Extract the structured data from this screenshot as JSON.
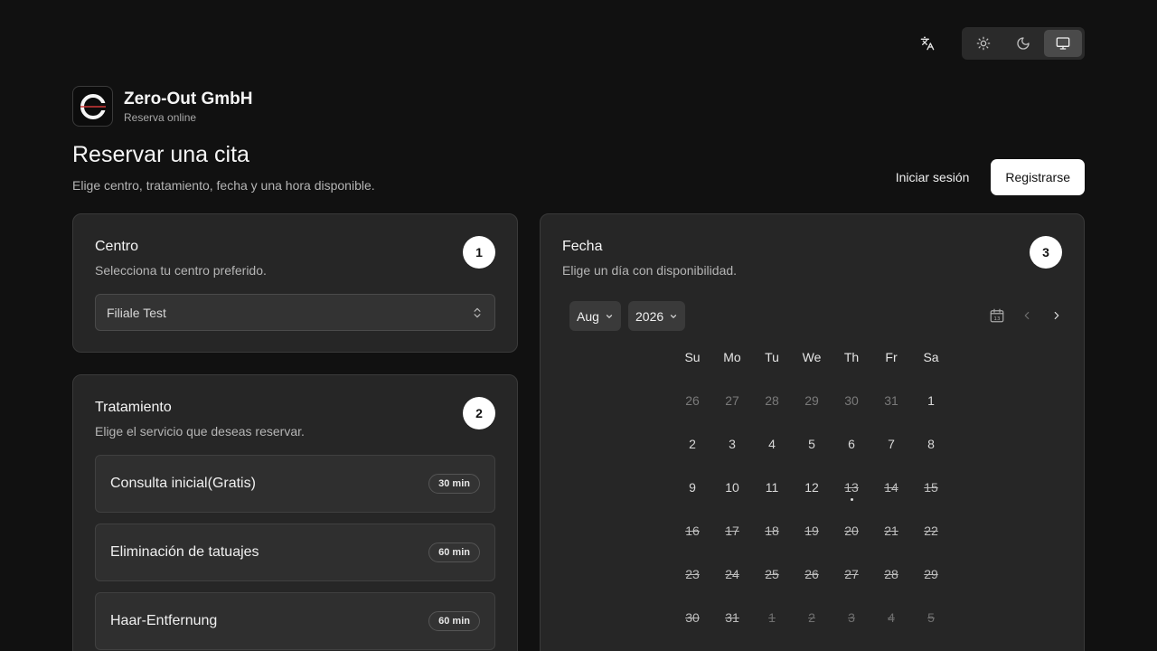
{
  "header": {
    "language_icon": "translate-icon",
    "theme_options": [
      {
        "name": "light",
        "icon": "sun-icon",
        "active": false
      },
      {
        "name": "dark",
        "icon": "moon-icon",
        "active": false
      },
      {
        "name": "system",
        "icon": "monitor-icon",
        "active": true
      }
    ]
  },
  "brand": {
    "name": "Zero-Out GmbH",
    "subtitle": "Reserva online"
  },
  "page": {
    "title": "Reservar una cita",
    "subtitle": "Elige centro, tratamiento, fecha y una hora disponible."
  },
  "auth": {
    "login_label": "Iniciar sesión",
    "register_label": "Registrarse"
  },
  "centro": {
    "step": "1",
    "title": "Centro",
    "description": "Selecciona tu centro preferido.",
    "selected": "Filiale Test"
  },
  "tratamiento": {
    "step": "2",
    "title": "Tratamiento",
    "description": "Elige el servicio que deseas reservar.",
    "services": [
      {
        "name": "Consulta inicial(Gratis)",
        "duration": "30 min"
      },
      {
        "name": "Eliminación de tatuajes",
        "duration": "60 min"
      },
      {
        "name": "Haar-Entfernung",
        "duration": "60 min"
      }
    ]
  },
  "fecha": {
    "step": "3",
    "title": "Fecha",
    "description": "Elige un día con disponibilidad.",
    "month": "Aug",
    "year": "2026",
    "weekdays": [
      "Su",
      "Mo",
      "Tu",
      "We",
      "Th",
      "Fr",
      "Sa"
    ],
    "days": [
      {
        "label": "26",
        "state": "outside"
      },
      {
        "label": "27",
        "state": "outside"
      },
      {
        "label": "28",
        "state": "outside"
      },
      {
        "label": "29",
        "state": "outside"
      },
      {
        "label": "30",
        "state": "outside"
      },
      {
        "label": "31",
        "state": "outside"
      },
      {
        "label": "1",
        "state": "avail"
      },
      {
        "label": "2",
        "state": "avail"
      },
      {
        "label": "3",
        "state": "avail"
      },
      {
        "label": "4",
        "state": "avail"
      },
      {
        "label": "5",
        "state": "avail"
      },
      {
        "label": "6",
        "state": "avail"
      },
      {
        "label": "7",
        "state": "avail"
      },
      {
        "label": "8",
        "state": "avail"
      },
      {
        "label": "9",
        "state": "avail"
      },
      {
        "label": "10",
        "state": "avail"
      },
      {
        "label": "11",
        "state": "avail"
      },
      {
        "label": "12",
        "state": "avail"
      },
      {
        "label": "13",
        "state": "unavail",
        "today": true
      },
      {
        "label": "14",
        "state": "unavail"
      },
      {
        "label": "15",
        "state": "unavail"
      },
      {
        "label": "16",
        "state": "unavail"
      },
      {
        "label": "17",
        "state": "unavail"
      },
      {
        "label": "18",
        "state": "unavail"
      },
      {
        "label": "19",
        "state": "unavail"
      },
      {
        "label": "20",
        "state": "unavail"
      },
      {
        "label": "21",
        "state": "unavail"
      },
      {
        "label": "22",
        "state": "unavail"
      },
      {
        "label": "23",
        "state": "unavail"
      },
      {
        "label": "24",
        "state": "unavail"
      },
      {
        "label": "25",
        "state": "unavail"
      },
      {
        "label": "26",
        "state": "unavail"
      },
      {
        "label": "27",
        "state": "unavail"
      },
      {
        "label": "28",
        "state": "unavail"
      },
      {
        "label": "29",
        "state": "unavail"
      },
      {
        "label": "30",
        "state": "unavail"
      },
      {
        "label": "31",
        "state": "unavail"
      },
      {
        "label": "1",
        "state": "outside unavail"
      },
      {
        "label": "2",
        "state": "outside unavail"
      },
      {
        "label": "3",
        "state": "outside unavail"
      },
      {
        "label": "4",
        "state": "outside unavail"
      },
      {
        "label": "5",
        "state": "outside unavail"
      }
    ],
    "today_calendar_icon_label": "13"
  }
}
